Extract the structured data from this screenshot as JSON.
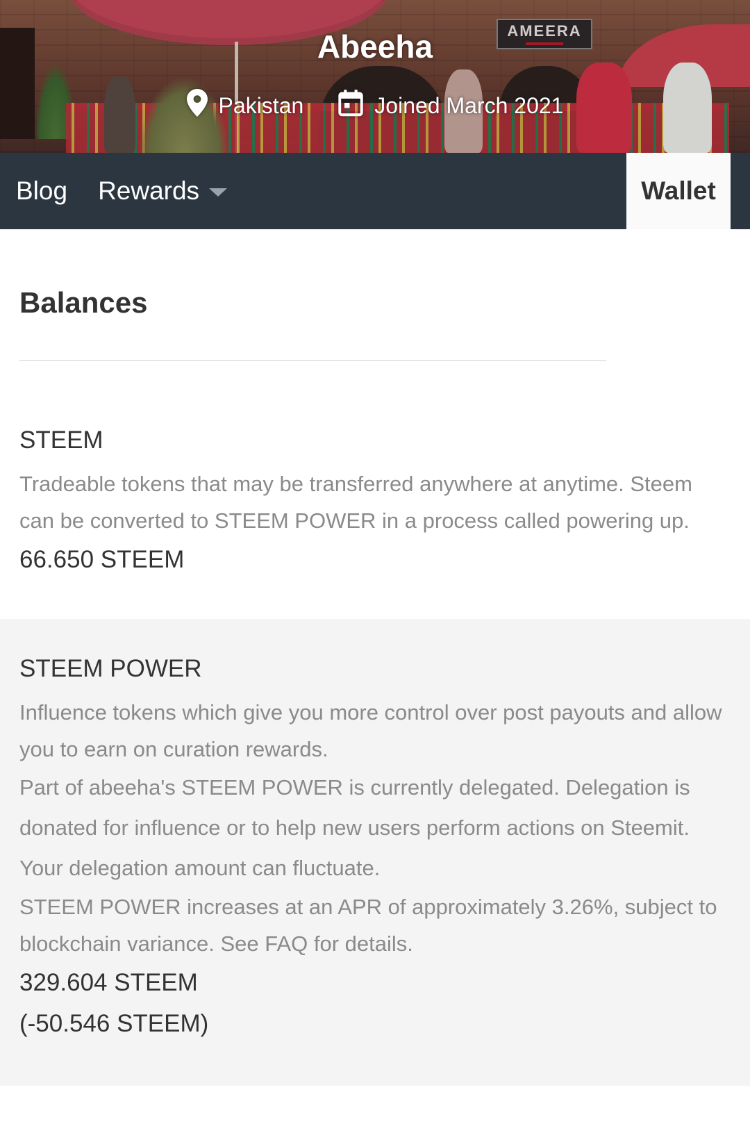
{
  "profile": {
    "name": "Abeeha",
    "location": "Pakistan",
    "joined": "Joined March 2021",
    "cover_sign_text": "AMEERA"
  },
  "nav": {
    "blog": "Blog",
    "rewards": "Rewards",
    "wallet": "Wallet"
  },
  "balances": {
    "title": "Balances",
    "steem": {
      "title": "STEEM",
      "description": "Tradeable tokens that may be transferred anywhere at anytime. Steem can be converted to STEEM POWER in a process called powering up.",
      "amount": "66.650 STEEM"
    },
    "steem_power": {
      "title": "STEEM POWER",
      "description_1": "Influence tokens which give you more control over post payouts and allow you to earn on curation rewards.",
      "description_2": "Part of abeeha's STEEM POWER is currently delegated. Delegation is donated for influence or to help new users perform actions on Steemit. Your delegation amount can fluctuate.",
      "description_3": "STEEM POWER increases at an APR of approximately 3.26%, subject to blockchain variance. See FAQ for details.",
      "amount": "329.604 STEEM",
      "delegated": "(-50.546 STEEM)"
    }
  },
  "colors": {
    "nav_background": "#2c3640",
    "section_grey": "#f4f4f4",
    "muted_text": "#8a8a8a"
  },
  "icons": {
    "location": "location-pin-icon",
    "joined": "calendar-icon",
    "rewards_dropdown": "caret-down-icon"
  }
}
